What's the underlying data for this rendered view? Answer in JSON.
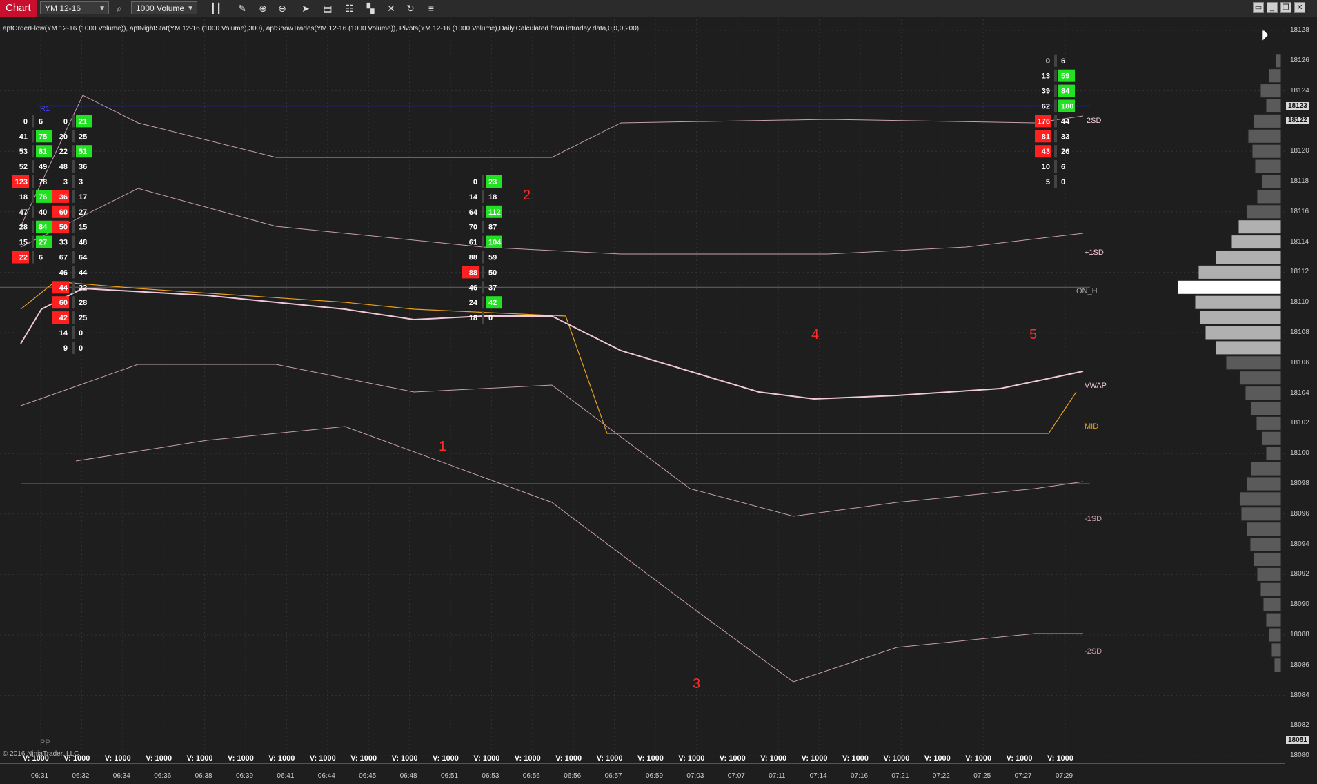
{
  "toolbar": {
    "chart_tab": "Chart",
    "instrument": "YM 12-16",
    "period": "1000 Volume",
    "icons": [
      "search-icon",
      "bars-icon",
      "pencil-icon",
      "zoom-in-icon",
      "zoom-out-icon",
      "pointer-icon",
      "properties-icon",
      "layout-icon",
      "cascade-icon",
      "crosshair-icon",
      "refresh-icon",
      "menu-icon"
    ]
  },
  "indicator_line": "aptOrderFlow(YM 12-16 (1000 Volume)), aptNightStat(YM 12-16 (1000 Volume),300), aptShowTrades(YM 12-16 (1000 Volume)), Pivots(YM 12-16 (1000 Volume),Daily,Calculated from intraday data,0,0,0,200)",
  "price_axis": {
    "labels": [
      "18128",
      "18126",
      "18124",
      "18123",
      "18122",
      "18120",
      "18118",
      "18116",
      "18114",
      "18112",
      "18110",
      "18108",
      "18106",
      "18104",
      "18102",
      "18100",
      "18098",
      "18096",
      "18094",
      "18092",
      "18090",
      "18088",
      "18086",
      "18084",
      "18082",
      "18081",
      "18080"
    ],
    "highlighted": [
      "18123",
      "18122",
      "18081"
    ]
  },
  "time_axis": {
    "labels": [
      "06:31",
      "06:32",
      "06:34",
      "06:36",
      "06:38",
      "06:39",
      "06:41",
      "06:44",
      "06:45",
      "06:48",
      "06:51",
      "06:53",
      "06:56",
      "06:56",
      "06:57",
      "06:59",
      "07:03",
      "07:07",
      "07:11",
      "07:14",
      "07:16",
      "07:21",
      "07:22",
      "07:25",
      "07:27",
      "07:29"
    ],
    "volume_label": "V: 1000"
  },
  "levels": {
    "plus2sd": "2SD",
    "plus1sd": "+1SD",
    "on_h": "ON_H",
    "vwap": "VWAP",
    "mid": "MID",
    "minus1sd": "-1SD",
    "minus2sd": "-2SD",
    "r1": "R1",
    "pp": "PP"
  },
  "annotations": [
    "1",
    "2",
    "3",
    "4",
    "5"
  ],
  "copyright": "© 2016 NinjaTrader, LLC",
  "colors": {
    "buy": "#22e022",
    "sell": "#ff2020",
    "vwap": "#f0c8d8",
    "mid": "#e8a020",
    "pivot": "#7030c0",
    "r1": "#2020c0"
  },
  "chart_data": {
    "type": "table",
    "title": "",
    "columns": [
      {
        "time": "06:31",
        "rows": [
          [
            18122,
            "0",
            "6"
          ],
          [
            18121,
            "41",
            "75"
          ],
          [
            18120,
            "53",
            "81"
          ],
          [
            18119,
            "52",
            "49"
          ],
          [
            18118,
            "123",
            "78"
          ],
          [
            18117,
            "18",
            "76"
          ],
          [
            18116,
            "47",
            "40"
          ],
          [
            18115,
            "28",
            "84"
          ],
          [
            18114,
            "15",
            "27"
          ],
          [
            18113,
            "22",
            "6"
          ]
        ]
      },
      {
        "time": "06:32",
        "rows": [
          [
            18122,
            "0",
            "21"
          ],
          [
            18121,
            "20",
            "25"
          ],
          [
            18120,
            "22",
            "51"
          ],
          [
            18119,
            "48",
            "36"
          ],
          [
            18118,
            "3",
            "3"
          ],
          [
            18117,
            "36",
            "17"
          ],
          [
            18116,
            "60",
            "27"
          ],
          [
            18115,
            "50",
            "15"
          ],
          [
            18114,
            "33",
            "48"
          ],
          [
            18113,
            "67",
            "64"
          ],
          [
            18112,
            "46",
            "44"
          ],
          [
            18111,
            "44",
            "22"
          ],
          [
            18110,
            "60",
            "28"
          ],
          [
            18109,
            "42",
            "25"
          ],
          [
            18108,
            "14",
            "0"
          ],
          [
            18107,
            "9",
            "0"
          ]
        ]
      },
      {
        "time": "06:53",
        "rows": [
          [
            18118,
            "0",
            "23"
          ],
          [
            18117,
            "14",
            "18"
          ],
          [
            18116,
            "64",
            "112"
          ],
          [
            18115,
            "70",
            "87"
          ],
          [
            18114,
            "61",
            "104"
          ],
          [
            18113,
            "88",
            "59"
          ],
          [
            18112,
            "88",
            "50"
          ],
          [
            18111,
            "46",
            "37"
          ],
          [
            18110,
            "24",
            "42"
          ],
          [
            18109,
            "18",
            "0"
          ]
        ]
      },
      {
        "time": "07:29",
        "rows": [
          [
            18126,
            "0",
            "6"
          ],
          [
            18125,
            "13",
            "59"
          ],
          [
            18124,
            "39",
            "84"
          ],
          [
            18123,
            "62",
            "180"
          ],
          [
            18122,
            "176",
            "44"
          ],
          [
            18121,
            "81",
            "33"
          ],
          [
            18120,
            "43",
            "26"
          ],
          [
            18119,
            "10",
            "6"
          ],
          [
            18118,
            "5",
            "0"
          ]
        ]
      }
    ],
    "ylim": [
      18080,
      18128
    ]
  }
}
